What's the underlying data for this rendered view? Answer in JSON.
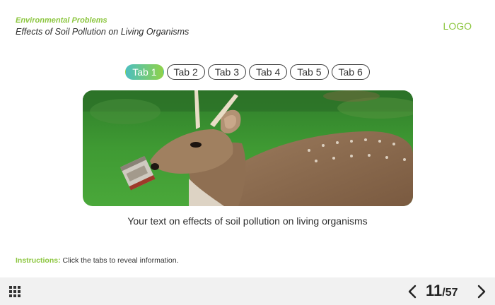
{
  "header": {
    "course_title": "Environmental Problems",
    "slide_title": "Effects of Soil Pollution on Living Organisms",
    "logo": "LOGO"
  },
  "tabs": [
    {
      "label": "Tab 1",
      "active": true
    },
    {
      "label": "Tab 2",
      "active": false
    },
    {
      "label": "Tab 3",
      "active": false
    },
    {
      "label": "Tab 4",
      "active": false
    },
    {
      "label": "Tab 5",
      "active": false
    },
    {
      "label": "Tab 6",
      "active": false
    }
  ],
  "content": {
    "body_text": "Your text on effects of soil pollution on living organisms"
  },
  "instructions": {
    "label": "Instructions:",
    "text": "Click the tabs to reveal information."
  },
  "footer": {
    "current_slide": "11",
    "separator": "/",
    "total_slides": "57",
    "menu_icon": "grid-menu-icon",
    "prev_icon": "chevron-left-icon",
    "next_icon": "chevron-right-icon"
  },
  "colors": {
    "accent_green": "#8cc63f",
    "tab_gradient_start": "#4dbfbf",
    "tab_gradient_end": "#8fd24a",
    "footer_bg": "#f1f1f1"
  }
}
